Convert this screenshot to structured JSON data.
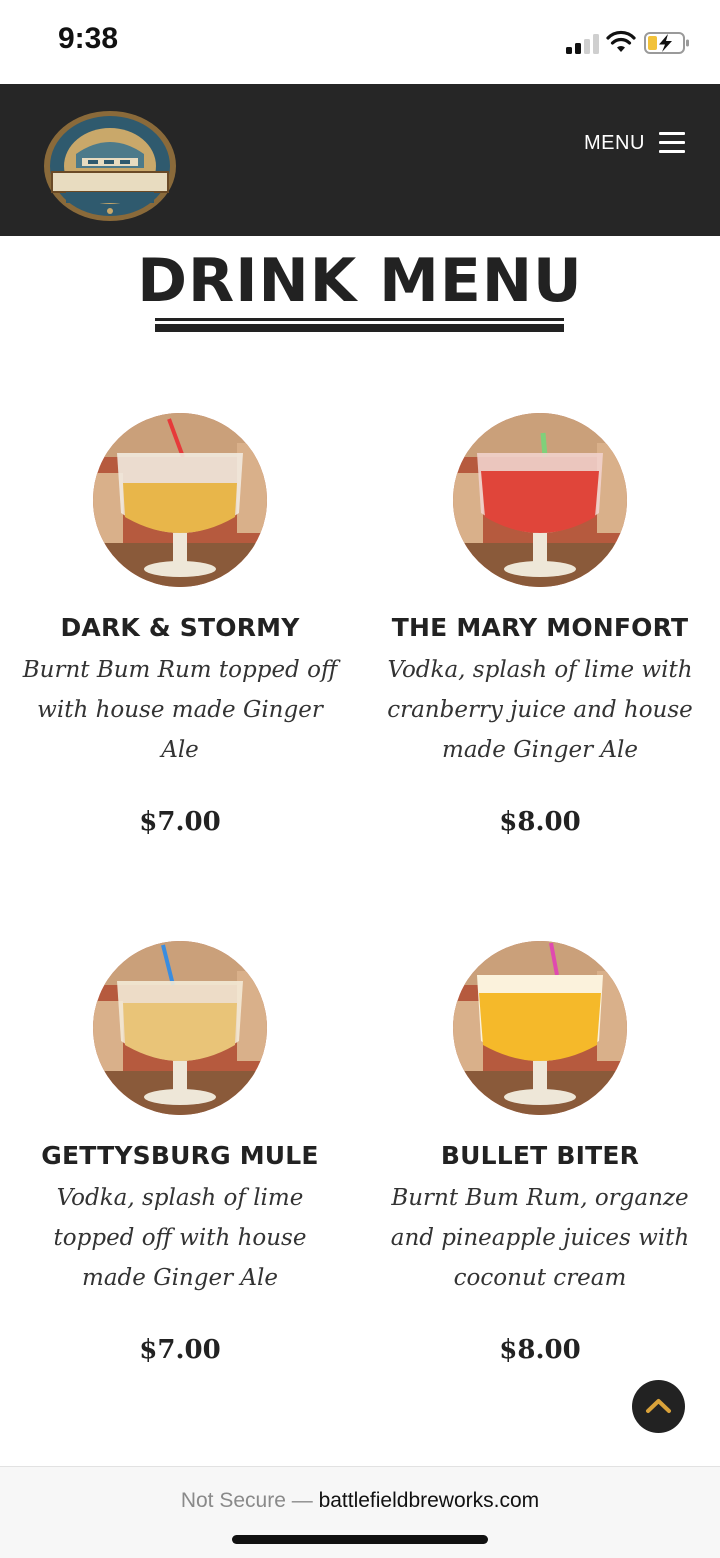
{
  "status_bar": {
    "time": "9:38"
  },
  "header": {
    "logo_icon": "battlefield-brew-works-logo",
    "menu_label": "MENU"
  },
  "page": {
    "title": "DRINK MENU"
  },
  "drinks": [
    {
      "name": "DARK & STORMY",
      "description": "Burnt Bum Rum topped off with house made Ginger Ale",
      "price": "$7.00",
      "liquid_color": "#e8b64a",
      "straw_color": "#e63a3a"
    },
    {
      "name": "THE MARY MONFORT",
      "description": "Vodka, splash of lime with cranberry juice and house made Ginger Ale",
      "price": "$8.00",
      "liquid_color": "#e0453a",
      "straw_color": "#7fd07a"
    },
    {
      "name": "GETTYSBURG MULE",
      "description": "Vodka, splash of lime topped off with house made Ginger Ale",
      "price": "$7.00",
      "liquid_color": "#e9c478",
      "straw_color": "#3a8de0"
    },
    {
      "name": "BULLET BITER",
      "description": "Burnt Bum Rum, organze and pineapple juices with coconut cream",
      "price": "$8.00",
      "liquid_color": "#f5b92a",
      "straw_color": "#e04ab0"
    }
  ],
  "browser": {
    "security_label": "Not Secure —",
    "url": "battlefieldbreworks.com"
  },
  "colors": {
    "header_bg": "#262626",
    "text": "#222222"
  }
}
